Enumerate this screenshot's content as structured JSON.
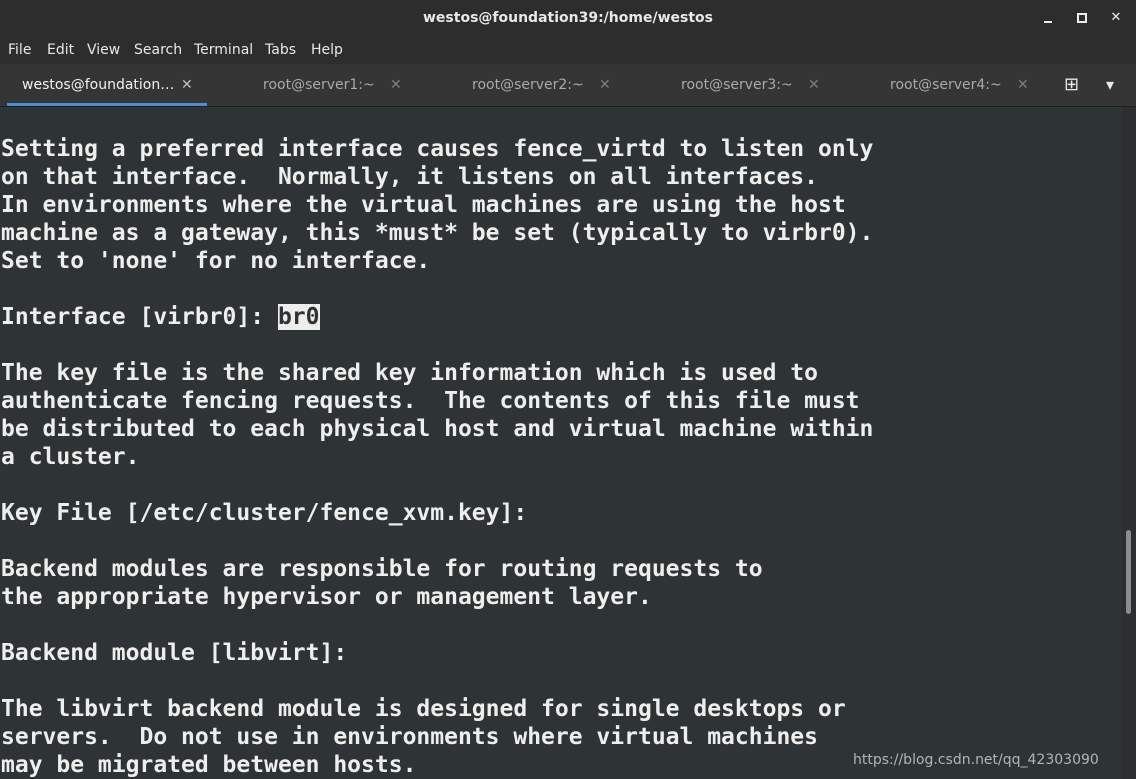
{
  "window": {
    "title": "westos@foundation39:/home/westos",
    "minimize_glyph": "",
    "maximize_glyph": "",
    "close_glyph": "✕"
  },
  "menu": [
    "File",
    "Edit",
    "View",
    "Search",
    "Terminal",
    "Tabs",
    "Help"
  ],
  "tabs": [
    {
      "label": "westos@foundation…",
      "close": "✕"
    },
    {
      "label": "root@server1:~",
      "close": "✕"
    },
    {
      "label": "root@server2:~",
      "close": "✕"
    },
    {
      "label": "root@server3:~",
      "close": "✕"
    },
    {
      "label": "root@server4:~",
      "close": "✕"
    }
  ],
  "tabbar_icons": {
    "new_tab": "new-tab-icon",
    "menu": "chevron-down-icon",
    "new_tab_glyph": "⊞",
    "menu_glyph": "▾"
  },
  "terminal": {
    "lines": [
      "Setting a preferred interface causes fence_virtd to listen only",
      "on that interface.  Normally, it listens on all interfaces.",
      "In environments where the virtual machines are using the host",
      "machine as a gateway, this *must* be set (typically to virbr0).",
      "Set to 'none' for no interface.",
      "",
      "",
      "",
      "The key file is the shared key information which is used to",
      "authenticate fencing requests.  The contents of this file must",
      "be distributed to each physical host and virtual machine within",
      "a cluster.",
      "",
      "Key File [/etc/cluster/fence_xvm.key]:",
      "",
      "Backend modules are responsible for routing requests to",
      "the appropriate hypervisor or management layer.",
      "",
      "Backend module [libvirt]:",
      "",
      "The libvirt backend module is designed for single desktops or",
      "servers.  Do not use in environments where virtual machines",
      "may be migrated between hosts."
    ],
    "prompt_line": {
      "prompt": "Interface [virbr0]: ",
      "input": "br0"
    },
    "scroll_position": 0.72
  },
  "watermark": "https://blog.csdn.net/qq_42303090"
}
